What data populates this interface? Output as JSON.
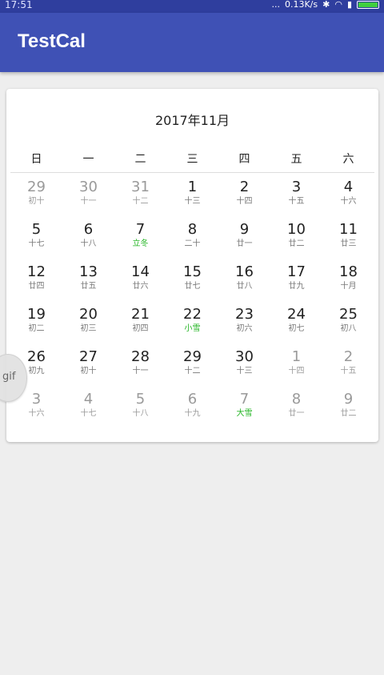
{
  "status_bar": {
    "time": "17:51",
    "network_speed": "0.13K/s",
    "signal_text": "..."
  },
  "app_bar": {
    "title": "TestCal"
  },
  "calendar": {
    "month_title": "2017年11月",
    "weekdays": [
      "日",
      "一",
      "二",
      "三",
      "四",
      "五",
      "六"
    ],
    "weeks": [
      [
        {
          "d": "29",
          "lunar": "初十",
          "other": true
        },
        {
          "d": "30",
          "lunar": "十一",
          "other": true
        },
        {
          "d": "31",
          "lunar": "十二",
          "other": true
        },
        {
          "d": "1",
          "lunar": "十三"
        },
        {
          "d": "2",
          "lunar": "十四"
        },
        {
          "d": "3",
          "lunar": "十五"
        },
        {
          "d": "4",
          "lunar": "十六"
        }
      ],
      [
        {
          "d": "5",
          "lunar": "十七"
        },
        {
          "d": "6",
          "lunar": "十八"
        },
        {
          "d": "7",
          "lunar": "立冬",
          "term": true
        },
        {
          "d": "8",
          "lunar": "二十"
        },
        {
          "d": "9",
          "lunar": "廿一"
        },
        {
          "d": "10",
          "lunar": "廿二"
        },
        {
          "d": "11",
          "lunar": "廿三"
        }
      ],
      [
        {
          "d": "12",
          "lunar": "廿四"
        },
        {
          "d": "13",
          "lunar": "廿五"
        },
        {
          "d": "14",
          "lunar": "廿六"
        },
        {
          "d": "15",
          "lunar": "廿七"
        },
        {
          "d": "16",
          "lunar": "廿八"
        },
        {
          "d": "17",
          "lunar": "廿九"
        },
        {
          "d": "18",
          "lunar": "十月"
        }
      ],
      [
        {
          "d": "19",
          "lunar": "初二"
        },
        {
          "d": "20",
          "lunar": "初三"
        },
        {
          "d": "21",
          "lunar": "初四"
        },
        {
          "d": "22",
          "lunar": "小雪",
          "term": true
        },
        {
          "d": "23",
          "lunar": "初六"
        },
        {
          "d": "24",
          "lunar": "初七"
        },
        {
          "d": "25",
          "lunar": "初八"
        }
      ],
      [
        {
          "d": "26",
          "lunar": "初九"
        },
        {
          "d": "27",
          "lunar": "初十"
        },
        {
          "d": "28",
          "lunar": "十一"
        },
        {
          "d": "29",
          "lunar": "十二"
        },
        {
          "d": "30",
          "lunar": "十三"
        },
        {
          "d": "1",
          "lunar": "十四",
          "other": true
        },
        {
          "d": "2",
          "lunar": "十五",
          "other": true
        }
      ],
      [
        {
          "d": "3",
          "lunar": "十六",
          "other": true
        },
        {
          "d": "4",
          "lunar": "十七",
          "other": true
        },
        {
          "d": "5",
          "lunar": "十八",
          "other": true
        },
        {
          "d": "6",
          "lunar": "十九",
          "other": true
        },
        {
          "d": "7",
          "lunar": "大雪",
          "other": true,
          "term": true
        },
        {
          "d": "8",
          "lunar": "廿一",
          "other": true
        },
        {
          "d": "9",
          "lunar": "廿二",
          "other": true
        }
      ]
    ]
  },
  "floating_badge": {
    "label": "gif"
  },
  "colors": {
    "app_bar": "#3f51b5",
    "status_bar": "#2f3e9e",
    "solar_term": "#23b523",
    "other_month": "#9a9a9a",
    "background": "#eeeeee"
  },
  "icons": [
    "wifi-icon",
    "signal-icon",
    "bluetooth-icon",
    "battery-icon"
  ]
}
